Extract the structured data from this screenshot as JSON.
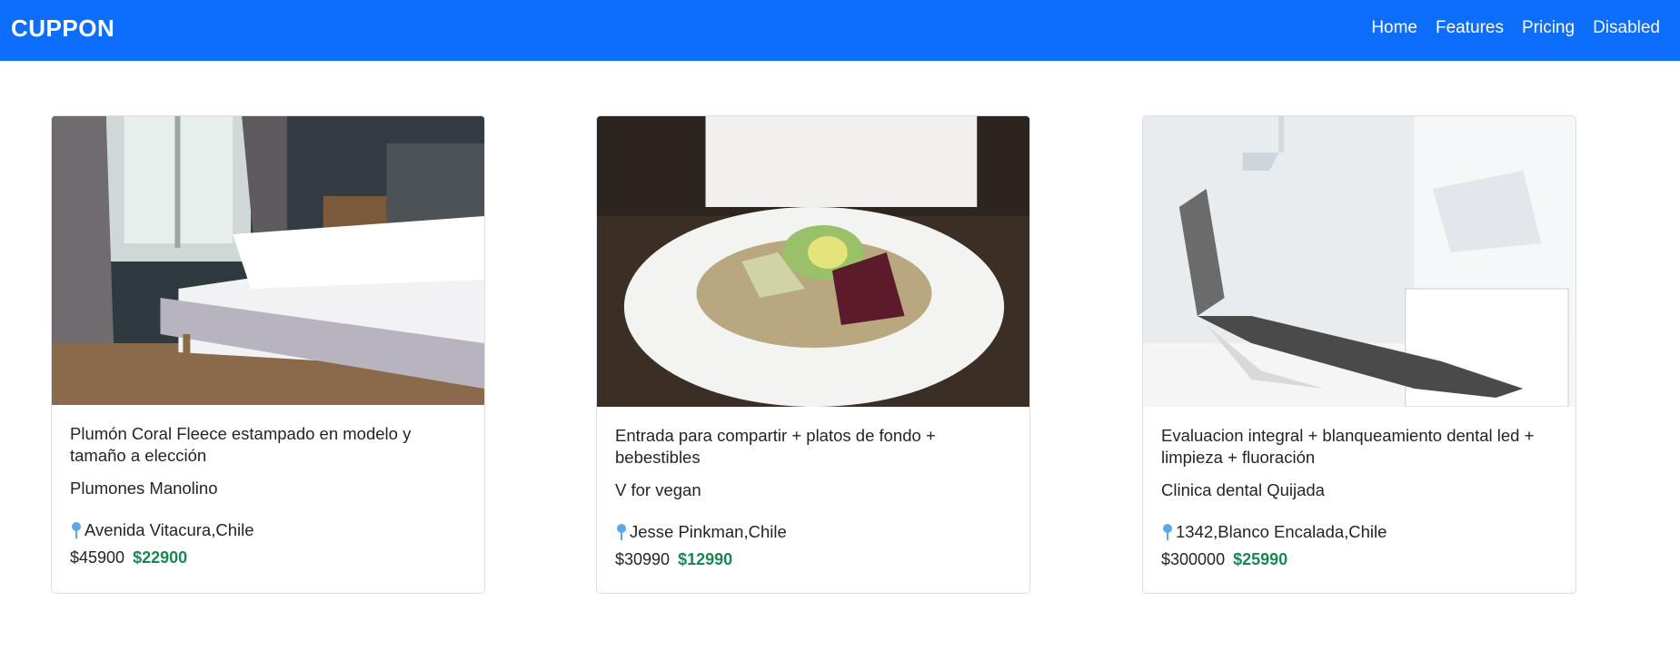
{
  "navbar": {
    "brand": "CUPPON",
    "links": [
      "Home",
      "Features",
      "Pricing",
      "Disabled"
    ],
    "bg": "#0d6efd"
  },
  "cards": [
    {
      "title": "Plumón Coral Fleece estampado en modelo y tamaño a elección",
      "company": "Plumones Manolino",
      "location": "Avenida Vitacura,Chile",
      "old_price": "$45900",
      "new_price": "$22900",
      "image": "bedroom-photo"
    },
    {
      "title": "Entrada para compartir + platos de fondo + bebestibles",
      "company": "V for vegan",
      "location": "Jesse Pinkman,Chile",
      "old_price": "$30990",
      "new_price": "$12990",
      "image": "salad-plate-photo"
    },
    {
      "title": "Evaluacion integral + blanqueamiento dental led + limpieza + fluoración",
      "company": "Clinica dental Quijada",
      "location": "1342,Blanco Encalada,Chile",
      "old_price": "$300000",
      "new_price": "$25990",
      "image": "dental-chair-photo"
    }
  ],
  "colors": {
    "accent": "#0d6efd",
    "sale": "#198754",
    "pin": "#5aa9e6"
  }
}
